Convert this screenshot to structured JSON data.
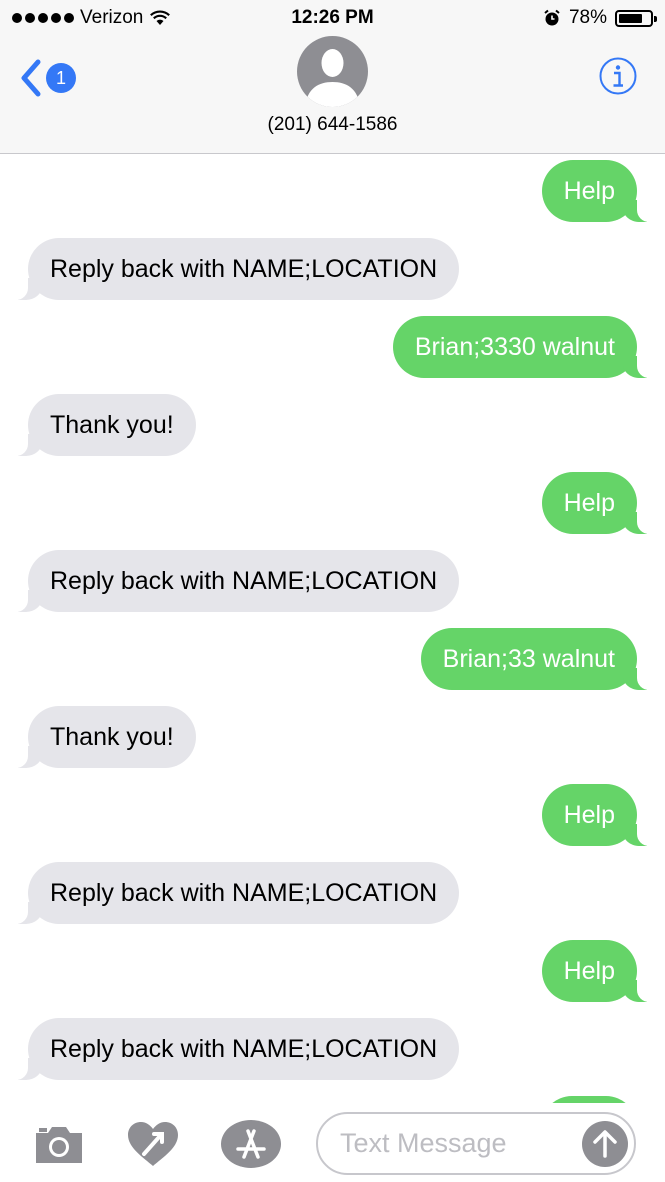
{
  "status": {
    "carrier": "Verizon",
    "time": "12:26 PM",
    "battery": "78%",
    "battery_level": 0.78
  },
  "header": {
    "back_badge": "1",
    "contact": "(201) 644-1586"
  },
  "messages": [
    {
      "dir": "out",
      "text": "Help"
    },
    {
      "dir": "in",
      "text": "Reply back with NAME;LOCATION"
    },
    {
      "dir": "out",
      "text": "Brian;3330 walnut"
    },
    {
      "dir": "in",
      "text": "Thank you!"
    },
    {
      "dir": "out",
      "text": "Help"
    },
    {
      "dir": "in",
      "text": "Reply back with NAME;LOCATION"
    },
    {
      "dir": "out",
      "text": "Brian;33 walnut"
    },
    {
      "dir": "in",
      "text": "Thank you!"
    },
    {
      "dir": "out",
      "text": "Help"
    },
    {
      "dir": "in",
      "text": "Reply back with NAME;LOCATION"
    },
    {
      "dir": "out",
      "text": "Help"
    },
    {
      "dir": "in",
      "text": "Reply back with NAME;LOCATION"
    }
  ],
  "input": {
    "placeholder": "Text Message",
    "value": ""
  },
  "icons": {
    "camera": "camera-icon",
    "digital_touch": "digital-touch-heart-icon",
    "app_store": "app-store-icon",
    "send": "send-arrow-icon"
  },
  "colors": {
    "sent_bubble": "#65d468",
    "received_bubble": "#e5e5ea",
    "accent": "#3478f6"
  }
}
